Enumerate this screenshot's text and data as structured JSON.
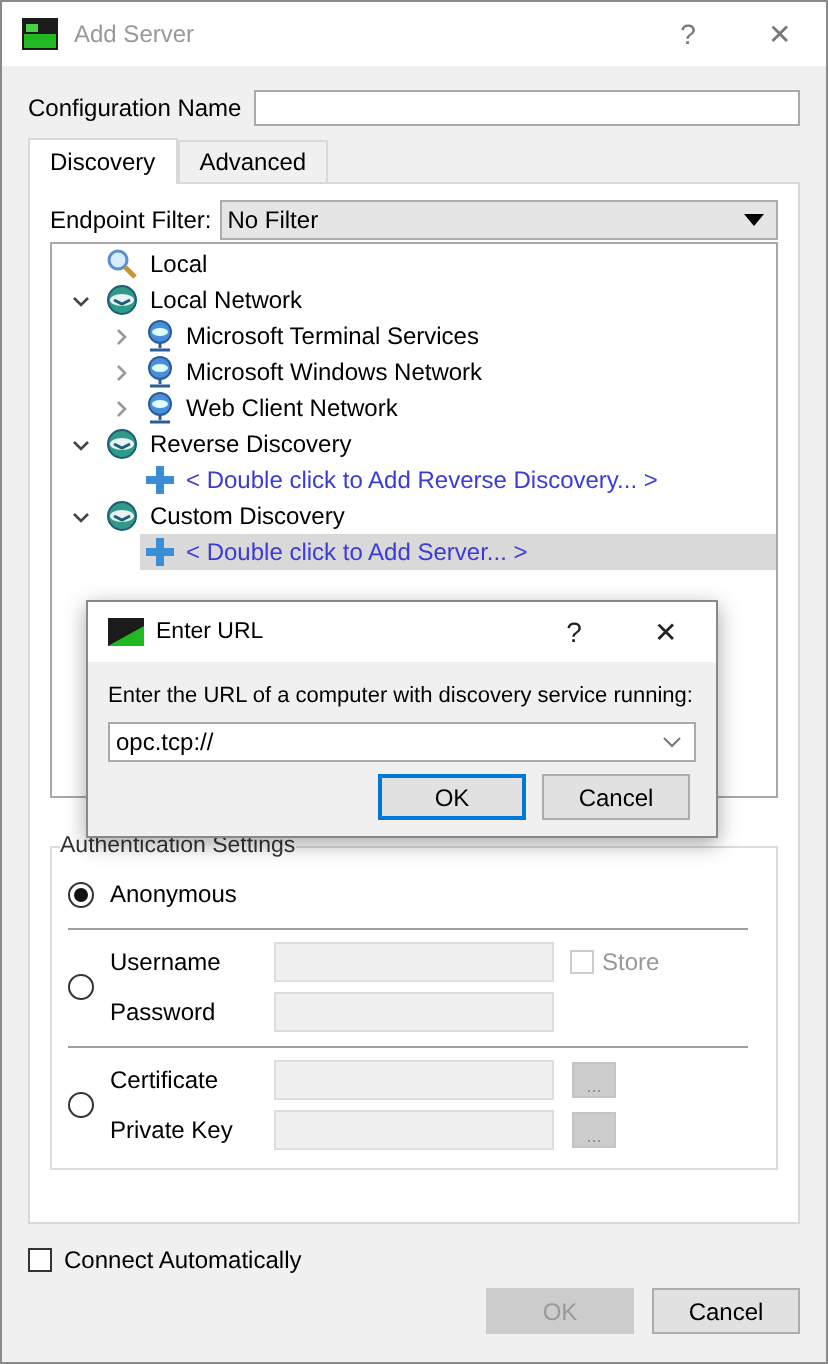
{
  "window": {
    "title": "Add Server",
    "help": "?",
    "close": "✕"
  },
  "config_name": {
    "label": "Configuration Name"
  },
  "tabs": [
    {
      "label": "Discovery",
      "selected": true
    },
    {
      "label": "Advanced",
      "selected": false
    }
  ],
  "endpoint_filter": {
    "label": "Endpoint Filter:",
    "value": "No Filter"
  },
  "tree": [
    {
      "label": "Local",
      "kind": "search",
      "selected": false
    },
    {
      "label": "Local Network",
      "kind": "network",
      "expanded": true,
      "selected": false,
      "children": [
        {
          "label": "Microsoft Terminal Services",
          "kind": "computer",
          "expanded": false,
          "selected": false
        },
        {
          "label": "Microsoft Windows Network",
          "kind": "computer",
          "expanded": false,
          "selected": false
        },
        {
          "label": "Web Client Network",
          "kind": "computer",
          "expanded": false,
          "selected": false
        }
      ]
    },
    {
      "label": "Reverse Discovery",
      "kind": "network",
      "expanded": true,
      "selected": false,
      "children": [
        {
          "label": "< Double click to Add Reverse Discovery... >",
          "kind": "add",
          "selected": false
        }
      ]
    },
    {
      "label": "Custom Discovery",
      "kind": "network",
      "expanded": true,
      "selected": false,
      "children": [
        {
          "label": "< Double click to Add Server... >",
          "kind": "add",
          "selected": true
        }
      ]
    }
  ],
  "auth": {
    "title": "Authentication Settings",
    "options": [
      {
        "selected": true,
        "fields": [
          {
            "label": "Anonymous",
            "kind": "none"
          }
        ]
      },
      {
        "selected": false,
        "fields": [
          {
            "label": "Username",
            "kind": "store",
            "store_label": "Store",
            "store_checked": false
          },
          {
            "label": "Password",
            "kind": "plain"
          }
        ]
      },
      {
        "selected": false,
        "fields": [
          {
            "label": "Certificate",
            "kind": "browse",
            "browse_label": "..."
          },
          {
            "label": "Private Key",
            "kind": "browse",
            "browse_label": "..."
          }
        ]
      }
    ]
  },
  "connect_automatically": {
    "label": "Connect Automatically",
    "checked": false
  },
  "buttons": [
    {
      "label": "OK",
      "disabled": true
    },
    {
      "label": "Cancel",
      "disabled": false
    }
  ],
  "dialog": {
    "title": "Enter URL",
    "help": "?",
    "close": "✕",
    "prompt": "Enter the URL of a computer with discovery service running:",
    "value": "opc.tcp://",
    "buttons": [
      {
        "label": "OK",
        "default": true
      },
      {
        "label": "Cancel",
        "default": false
      }
    ]
  }
}
